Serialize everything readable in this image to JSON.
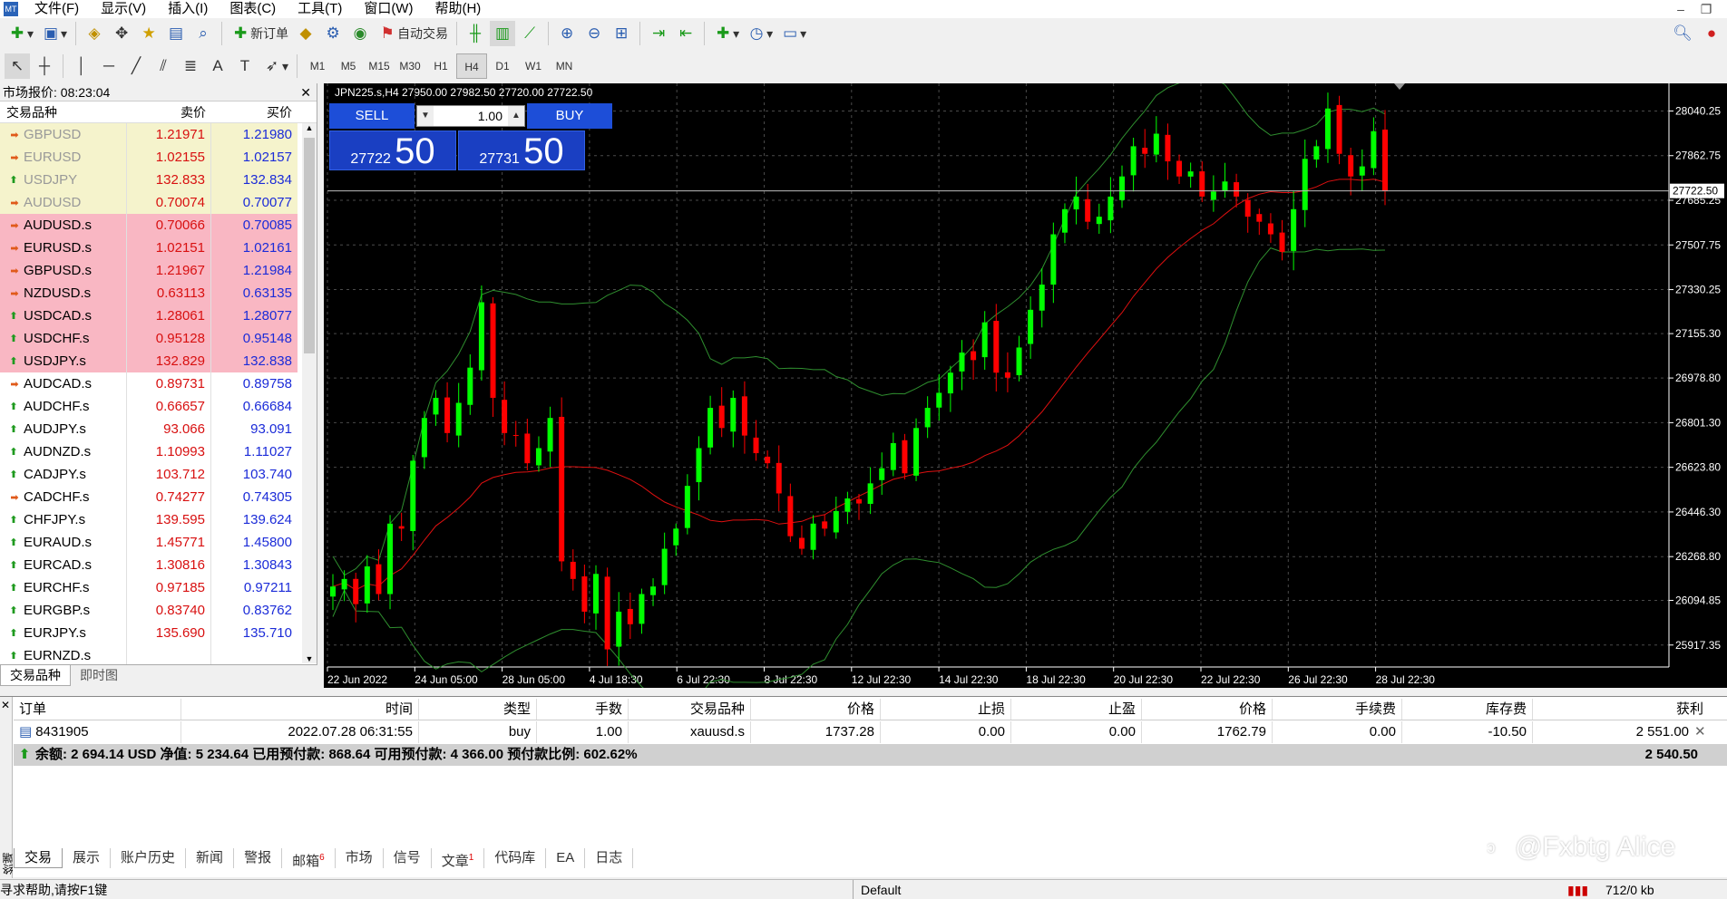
{
  "menu": [
    "文件(F)",
    "显示(V)",
    "插入(I)",
    "图表(C)",
    "工具(T)",
    "窗口(W)",
    "帮助(H)"
  ],
  "toolbar": {
    "new_order": "新订单",
    "auto_trading": "自动交易"
  },
  "timeframes": [
    "M1",
    "M5",
    "M15",
    "M30",
    "H1",
    "H4",
    "D1",
    "W1",
    "MN"
  ],
  "active_timeframe": "H4",
  "market_watch": {
    "title": "市场报价: 08:23:04",
    "headers": {
      "symbol": "交易品种",
      "bid": "卖价",
      "ask": "买价"
    },
    "rows": [
      {
        "symbol": "GBPUSD",
        "bid": "1.21971",
        "ask": "1.21980",
        "dir": "down",
        "hl": "y"
      },
      {
        "symbol": "EURUSD",
        "bid": "1.02155",
        "ask": "1.02157",
        "dir": "down",
        "hl": "y"
      },
      {
        "symbol": "USDJPY",
        "bid": "132.833",
        "ask": "132.834",
        "dir": "up",
        "hl": "y"
      },
      {
        "symbol": "AUDUSD",
        "bid": "0.70074",
        "ask": "0.70077",
        "dir": "down",
        "hl": "y"
      },
      {
        "symbol": "AUDUSD.s",
        "bid": "0.70066",
        "ask": "0.70085",
        "dir": "down",
        "hl": "p"
      },
      {
        "symbol": "EURUSD.s",
        "bid": "1.02151",
        "ask": "1.02161",
        "dir": "down",
        "hl": "p"
      },
      {
        "symbol": "GBPUSD.s",
        "bid": "1.21967",
        "ask": "1.21984",
        "dir": "down",
        "hl": "p"
      },
      {
        "symbol": "NZDUSD.s",
        "bid": "0.63113",
        "ask": "0.63135",
        "dir": "down",
        "hl": "p"
      },
      {
        "symbol": "USDCAD.s",
        "bid": "1.28061",
        "ask": "1.28077",
        "dir": "up",
        "hl": "p"
      },
      {
        "symbol": "USDCHF.s",
        "bid": "0.95128",
        "ask": "0.95148",
        "dir": "up",
        "hl": "p"
      },
      {
        "symbol": "USDJPY.s",
        "bid": "132.829",
        "ask": "132.838",
        "dir": "up",
        "hl": "p"
      },
      {
        "symbol": "AUDCAD.s",
        "bid": "0.89731",
        "ask": "0.89758",
        "dir": "down",
        "hl": ""
      },
      {
        "symbol": "AUDCHF.s",
        "bid": "0.66657",
        "ask": "0.66684",
        "dir": "up",
        "hl": ""
      },
      {
        "symbol": "AUDJPY.s",
        "bid": "93.066",
        "ask": "93.091",
        "dir": "up",
        "hl": ""
      },
      {
        "symbol": "AUDNZD.s",
        "bid": "1.10993",
        "ask": "1.11027",
        "dir": "up",
        "hl": ""
      },
      {
        "symbol": "CADJPY.s",
        "bid": "103.712",
        "ask": "103.740",
        "dir": "up",
        "hl": ""
      },
      {
        "symbol": "CADCHF.s",
        "bid": "0.74277",
        "ask": "0.74305",
        "dir": "down",
        "hl": ""
      },
      {
        "symbol": "CHFJPY.s",
        "bid": "139.595",
        "ask": "139.624",
        "dir": "up",
        "hl": ""
      },
      {
        "symbol": "EURAUD.s",
        "bid": "1.45771",
        "ask": "1.45800",
        "dir": "up",
        "hl": ""
      },
      {
        "symbol": "EURCAD.s",
        "bid": "1.30816",
        "ask": "1.30843",
        "dir": "up",
        "hl": ""
      },
      {
        "symbol": "EURCHF.s",
        "bid": "0.97185",
        "ask": "0.97211",
        "dir": "up",
        "hl": ""
      },
      {
        "symbol": "EURGBP.s",
        "bid": "0.83740",
        "ask": "0.83762",
        "dir": "up",
        "hl": ""
      },
      {
        "symbol": "EURJPY.s",
        "bid": "135.690",
        "ask": "135.710",
        "dir": "up",
        "hl": ""
      },
      {
        "symbol": "EURNZD.s",
        "bid": "",
        "ask": "",
        "dir": "up",
        "hl": ""
      }
    ],
    "tabs": [
      "交易品种",
      "即时图"
    ]
  },
  "chart": {
    "header": "JPN225.s,H4  27950.00 27982.50 27720.00 27722.50",
    "one_click": {
      "sell": "SELL",
      "buy": "BUY",
      "lots": "1.00",
      "sell_small": "27722",
      "sell_big": "50",
      "buy_small": "27731",
      "buy_big": "50"
    },
    "current_price_label": "27722.50",
    "colors": {
      "bull": "#00ff00",
      "bear": "#ff0000",
      "bands": "#2f8f2f",
      "ma": "#e01010",
      "bg": "#000000",
      "grid": "#4a4a4a"
    }
  },
  "chart_data": {
    "type": "candlestick",
    "symbol": "JPN225.s",
    "timeframe": "H4",
    "ylim": [
      25830,
      28150
    ],
    "yticks": [
      "28040.25",
      "27862.75",
      "27685.25",
      "27507.75",
      "27330.25",
      "27155.30",
      "26978.80",
      "26801.30",
      "26623.80",
      "26446.30",
      "26268.80",
      "26094.85",
      "25917.35"
    ],
    "xticks": [
      "22 Jun 2022",
      "24 Jun 05:00",
      "28 Jun 05:00",
      "4 Jul 18:30",
      "6 Jul 22:30",
      "8 Jul 22:30",
      "12 Jul 22:30",
      "14 Jul 22:30",
      "18 Jul 22:30",
      "20 Jul 22:30",
      "22 Jul 22:30",
      "26 Jul 22:30",
      "28 Jul 22:30"
    ],
    "close_series": [
      26150,
      26180,
      26080,
      26230,
      26120,
      26400,
      26380,
      26650,
      26820,
      26900,
      26760,
      26880,
      27020,
      27280,
      26900,
      26760,
      26750,
      26640,
      26700,
      26820,
      26250,
      26180,
      26050,
      26200,
      25900,
      26050,
      26000,
      26120,
      26150,
      26300,
      26380,
      26550,
      26700,
      26860,
      26780,
      26900,
      26750,
      26680,
      26640,
      26520,
      26350,
      26300,
      26400,
      26380,
      26450,
      26500,
      26480,
      26560,
      26620,
      26720,
      26600,
      26780,
      26860,
      26920,
      27000,
      27080,
      27050,
      27200,
      27000,
      26980,
      27100,
      27250,
      27350,
      27550,
      27650,
      27700,
      27600,
      27620,
      27700,
      27780,
      27900,
      27870,
      27950,
      27840,
      27780,
      27800,
      27700,
      27720,
      27760,
      27700,
      27620,
      27600,
      27550,
      27480,
      27650,
      27850,
      27900,
      28050,
      27870,
      27780,
      27820,
      27960,
      27722.5
    ]
  },
  "terminal": {
    "headers": [
      "订单",
      "时间",
      "类型",
      "手数",
      "交易品种",
      "价格",
      "止损",
      "止盈",
      "价格",
      "手续费",
      "库存费",
      "获利"
    ],
    "row": [
      "8431905",
      "2022.07.28 06:31:55",
      "buy",
      "1.00",
      "xauusd.s",
      "1737.28",
      "0.00",
      "0.00",
      "1762.79",
      "0.00",
      "-10.50",
      "2 551.00"
    ],
    "balance": "余额: 2 694.14 USD  净值: 5 234.64  已用预付款: 868.64  可用预付款: 4 366.00  预付款比例: 602.62%",
    "total": "2 540.50",
    "side_label": "终端",
    "tabs": [
      {
        "label": "交易",
        "badge": ""
      },
      {
        "label": "展示",
        "badge": ""
      },
      {
        "label": "账户历史",
        "badge": ""
      },
      {
        "label": "新闻",
        "badge": ""
      },
      {
        "label": "警报",
        "badge": ""
      },
      {
        "label": "邮箱",
        "badge": "6"
      },
      {
        "label": "市场",
        "badge": ""
      },
      {
        "label": "信号",
        "badge": ""
      },
      {
        "label": "文章",
        "badge": "1"
      },
      {
        "label": "代码库",
        "badge": ""
      },
      {
        "label": "EA",
        "badge": ""
      },
      {
        "label": "日志",
        "badge": ""
      }
    ]
  },
  "status": {
    "help": "寻求帮助,请按F1键",
    "profile": "Default",
    "traffic": "712/0 kb"
  },
  "watermark": "@Fxbtg Alice"
}
